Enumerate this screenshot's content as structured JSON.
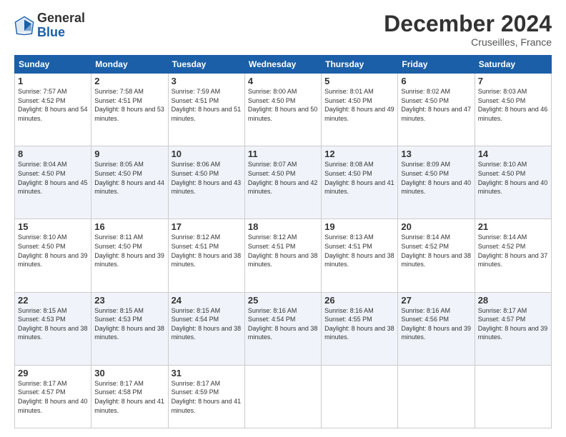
{
  "logo": {
    "general": "General",
    "blue": "Blue"
  },
  "title": "December 2024",
  "subtitle": "Cruseilles, France",
  "days_header": [
    "Sunday",
    "Monday",
    "Tuesday",
    "Wednesday",
    "Thursday",
    "Friday",
    "Saturday"
  ],
  "weeks": [
    {
      "stripe": false,
      "days": [
        {
          "num": "1",
          "rise": "7:57 AM",
          "set": "4:52 PM",
          "daylight": "8 hours and 54 minutes."
        },
        {
          "num": "2",
          "rise": "7:58 AM",
          "set": "4:51 PM",
          "daylight": "8 hours and 53 minutes."
        },
        {
          "num": "3",
          "rise": "7:59 AM",
          "set": "4:51 PM",
          "daylight": "8 hours and 51 minutes."
        },
        {
          "num": "4",
          "rise": "8:00 AM",
          "set": "4:50 PM",
          "daylight": "8 hours and 50 minutes."
        },
        {
          "num": "5",
          "rise": "8:01 AM",
          "set": "4:50 PM",
          "daylight": "8 hours and 49 minutes."
        },
        {
          "num": "6",
          "rise": "8:02 AM",
          "set": "4:50 PM",
          "daylight": "8 hours and 47 minutes."
        },
        {
          "num": "7",
          "rise": "8:03 AM",
          "set": "4:50 PM",
          "daylight": "8 hours and 46 minutes."
        }
      ]
    },
    {
      "stripe": true,
      "days": [
        {
          "num": "8",
          "rise": "8:04 AM",
          "set": "4:50 PM",
          "daylight": "8 hours and 45 minutes."
        },
        {
          "num": "9",
          "rise": "8:05 AM",
          "set": "4:50 PM",
          "daylight": "8 hours and 44 minutes."
        },
        {
          "num": "10",
          "rise": "8:06 AM",
          "set": "4:50 PM",
          "daylight": "8 hours and 43 minutes."
        },
        {
          "num": "11",
          "rise": "8:07 AM",
          "set": "4:50 PM",
          "daylight": "8 hours and 42 minutes."
        },
        {
          "num": "12",
          "rise": "8:08 AM",
          "set": "4:50 PM",
          "daylight": "8 hours and 41 minutes."
        },
        {
          "num": "13",
          "rise": "8:09 AM",
          "set": "4:50 PM",
          "daylight": "8 hours and 40 minutes."
        },
        {
          "num": "14",
          "rise": "8:10 AM",
          "set": "4:50 PM",
          "daylight": "8 hours and 40 minutes."
        }
      ]
    },
    {
      "stripe": false,
      "days": [
        {
          "num": "15",
          "rise": "8:10 AM",
          "set": "4:50 PM",
          "daylight": "8 hours and 39 minutes."
        },
        {
          "num": "16",
          "rise": "8:11 AM",
          "set": "4:50 PM",
          "daylight": "8 hours and 39 minutes."
        },
        {
          "num": "17",
          "rise": "8:12 AM",
          "set": "4:51 PM",
          "daylight": "8 hours and 38 minutes."
        },
        {
          "num": "18",
          "rise": "8:12 AM",
          "set": "4:51 PM",
          "daylight": "8 hours and 38 minutes."
        },
        {
          "num": "19",
          "rise": "8:13 AM",
          "set": "4:51 PM",
          "daylight": "8 hours and 38 minutes."
        },
        {
          "num": "20",
          "rise": "8:14 AM",
          "set": "4:52 PM",
          "daylight": "8 hours and 38 minutes."
        },
        {
          "num": "21",
          "rise": "8:14 AM",
          "set": "4:52 PM",
          "daylight": "8 hours and 37 minutes."
        }
      ]
    },
    {
      "stripe": true,
      "days": [
        {
          "num": "22",
          "rise": "8:15 AM",
          "set": "4:53 PM",
          "daylight": "8 hours and 38 minutes."
        },
        {
          "num": "23",
          "rise": "8:15 AM",
          "set": "4:53 PM",
          "daylight": "8 hours and 38 minutes."
        },
        {
          "num": "24",
          "rise": "8:15 AM",
          "set": "4:54 PM",
          "daylight": "8 hours and 38 minutes."
        },
        {
          "num": "25",
          "rise": "8:16 AM",
          "set": "4:54 PM",
          "daylight": "8 hours and 38 minutes."
        },
        {
          "num": "26",
          "rise": "8:16 AM",
          "set": "4:55 PM",
          "daylight": "8 hours and 38 minutes."
        },
        {
          "num": "27",
          "rise": "8:16 AM",
          "set": "4:56 PM",
          "daylight": "8 hours and 39 minutes."
        },
        {
          "num": "28",
          "rise": "8:17 AM",
          "set": "4:57 PM",
          "daylight": "8 hours and 39 minutes."
        }
      ]
    },
    {
      "stripe": false,
      "last": true,
      "days": [
        {
          "num": "29",
          "rise": "8:17 AM",
          "set": "4:57 PM",
          "daylight": "8 hours and 40 minutes."
        },
        {
          "num": "30",
          "rise": "8:17 AM",
          "set": "4:58 PM",
          "daylight": "8 hours and 41 minutes."
        },
        {
          "num": "31",
          "rise": "8:17 AM",
          "set": "4:59 PM",
          "daylight": "8 hours and 41 minutes."
        },
        null,
        null,
        null,
        null
      ]
    }
  ]
}
